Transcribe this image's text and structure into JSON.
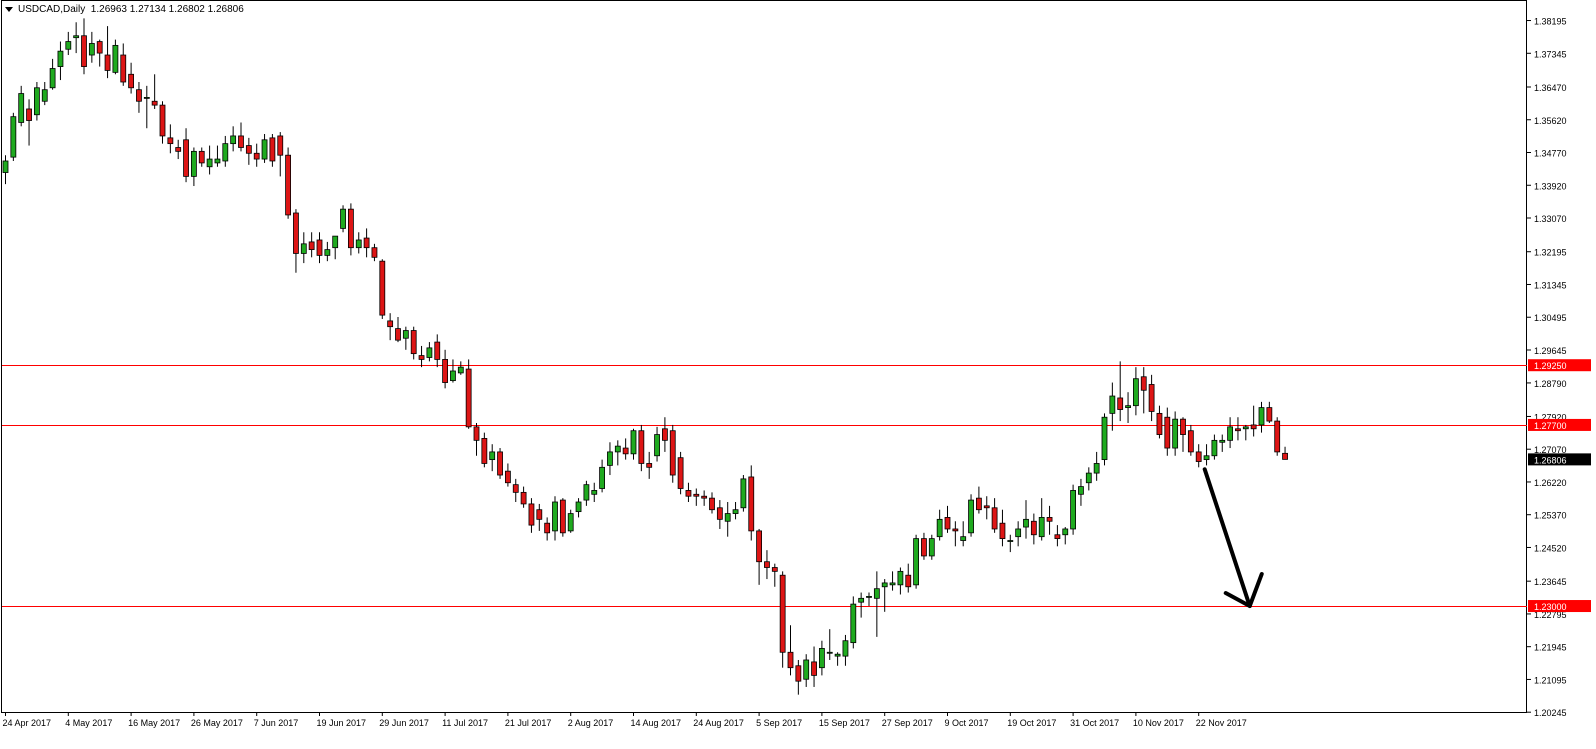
{
  "chart_title": {
    "symbol_tf": "USDCAD,Daily",
    "ohlc": [
      "1.26963",
      "1.27134",
      "1.26802",
      "1.26806"
    ]
  },
  "colors": {
    "bull": "#1faa1f",
    "bear": "#dd1515",
    "level_line": "#ff0000",
    "axis": "#000000",
    "current_price_bg": "#000000",
    "arrow": "#000000"
  },
  "chart_data": {
    "type": "candlestick",
    "symbol": "USDCAD",
    "timeframe": "Daily",
    "ylim": [
      1.2025,
      1.3865
    ],
    "y_ticks": [
      "1.38195",
      "1.37345",
      "1.36470",
      "1.35620",
      "1.34770",
      "1.33920",
      "1.33070",
      "1.32195",
      "1.31345",
      "1.30495",
      "1.29645",
      "1.28790",
      "1.27920",
      "1.27070",
      "1.26220",
      "1.25370",
      "1.24520",
      "1.23645",
      "1.22795",
      "1.21945",
      "1.21095",
      "1.20245"
    ],
    "x_labels": [
      {
        "label": "24 Apr 2017",
        "index": 0
      },
      {
        "label": "4 May 2017",
        "index": 8
      },
      {
        "label": "16 May 2017",
        "index": 16
      },
      {
        "label": "26 May 2017",
        "index": 24
      },
      {
        "label": "7 Jun 2017",
        "index": 32
      },
      {
        "label": "19 Jun 2017",
        "index": 40
      },
      {
        "label": "29 Jun 2017",
        "index": 48
      },
      {
        "label": "11 Jul 2017",
        "index": 56
      },
      {
        "label": "21 Jul 2017",
        "index": 64
      },
      {
        "label": "2 Aug 2017",
        "index": 72
      },
      {
        "label": "14 Aug 2017",
        "index": 80
      },
      {
        "label": "24 Aug 2017",
        "index": 88
      },
      {
        "label": "5 Sep 2017",
        "index": 96
      },
      {
        "label": "15 Sep 2017",
        "index": 104
      },
      {
        "label": "27 Sep 2017",
        "index": 112
      },
      {
        "label": "9 Oct 2017",
        "index": 120
      },
      {
        "label": "19 Oct 2017",
        "index": 128
      },
      {
        "label": "31 Oct 2017",
        "index": 136
      },
      {
        "label": "10 Nov 2017",
        "index": 144
      },
      {
        "label": "22 Nov 2017",
        "index": 152
      }
    ],
    "horizontal_levels": [
      {
        "price": 1.2925,
        "label": "1.29250"
      },
      {
        "price": 1.277,
        "label": "1.27700"
      },
      {
        "price": 1.23,
        "label": "1.23000"
      }
    ],
    "current_price": {
      "price": 1.26806,
      "label": "1.26806"
    },
    "projection_arrow": {
      "from_index": 152,
      "from_price": 1.2655,
      "to_index": 158.5,
      "to_price": 1.23
    },
    "candles": [
      [
        1.3425,
        1.347,
        1.3395,
        1.3455
      ],
      [
        1.3465,
        1.358,
        1.3455,
        1.357
      ],
      [
        1.3555,
        1.365,
        1.3545,
        1.363
      ],
      [
        1.359,
        1.3615,
        1.3495,
        1.356
      ],
      [
        1.3575,
        1.366,
        1.356,
        1.3645
      ],
      [
        1.361,
        1.366,
        1.36,
        1.364
      ],
      [
        1.3645,
        1.372,
        1.364,
        1.3695
      ],
      [
        1.37,
        1.3765,
        1.3665,
        1.374
      ],
      [
        1.3745,
        1.379,
        1.373,
        1.3765
      ],
      [
        1.3775,
        1.3815,
        1.3735,
        1.378
      ],
      [
        1.378,
        1.3825,
        1.368,
        1.37
      ],
      [
        1.373,
        1.379,
        1.371,
        1.376
      ],
      [
        1.3765,
        1.377,
        1.37,
        1.3735
      ],
      [
        1.373,
        1.3805,
        1.367,
        1.369
      ],
      [
        1.3685,
        1.377,
        1.368,
        1.3755
      ],
      [
        1.373,
        1.376,
        1.365,
        1.366
      ],
      [
        1.368,
        1.371,
        1.363,
        1.3645
      ],
      [
        1.364,
        1.366,
        1.358,
        1.361
      ],
      [
        1.362,
        1.365,
        1.354,
        1.362
      ],
      [
        1.361,
        1.368,
        1.359,
        1.36
      ],
      [
        1.36,
        1.361,
        1.35,
        1.352
      ],
      [
        1.3515,
        1.355,
        1.3475,
        1.35
      ],
      [
        1.349,
        1.351,
        1.346,
        1.348
      ],
      [
        1.351,
        1.354,
        1.34,
        1.3415
      ],
      [
        1.3415,
        1.349,
        1.339,
        1.348
      ],
      [
        1.348,
        1.349,
        1.344,
        1.345
      ],
      [
        1.344,
        1.3495,
        1.342,
        1.346
      ],
      [
        1.345,
        1.3495,
        1.344,
        1.346
      ],
      [
        1.3455,
        1.352,
        1.344,
        1.35
      ],
      [
        1.35,
        1.3545,
        1.348,
        1.352
      ],
      [
        1.352,
        1.3555,
        1.348,
        1.349
      ],
      [
        1.3495,
        1.3515,
        1.3445,
        1.3475
      ],
      [
        1.3475,
        1.35,
        1.344,
        1.346
      ],
      [
        1.346,
        1.3525,
        1.345,
        1.351
      ],
      [
        1.3515,
        1.3525,
        1.344,
        1.3455
      ],
      [
        1.352,
        1.353,
        1.3415,
        1.347
      ],
      [
        1.347,
        1.349,
        1.3305,
        1.3315
      ],
      [
        1.332,
        1.333,
        1.3165,
        1.3215
      ],
      [
        1.3215,
        1.327,
        1.319,
        1.324
      ],
      [
        1.3245,
        1.327,
        1.3205,
        1.3225
      ],
      [
        1.325,
        1.327,
        1.319,
        1.321
      ],
      [
        1.321,
        1.3245,
        1.3195,
        1.3225
      ],
      [
        1.323,
        1.326,
        1.32,
        1.326
      ],
      [
        1.328,
        1.334,
        1.327,
        1.333
      ],
      [
        1.333,
        1.3345,
        1.321,
        1.323
      ],
      [
        1.323,
        1.327,
        1.3215,
        1.325
      ],
      [
        1.3255,
        1.328,
        1.3205,
        1.323
      ],
      [
        1.323,
        1.324,
        1.3195,
        1.3205
      ],
      [
        1.3195,
        1.32,
        1.3045,
        1.3055
      ],
      [
        1.304,
        1.306,
        1.299,
        1.3025
      ],
      [
        1.302,
        1.305,
        1.2985,
        1.299
      ],
      [
        1.2995,
        1.3025,
        1.2965,
        1.3015
      ],
      [
        1.3015,
        1.3025,
        1.294,
        1.2955
      ],
      [
        1.295,
        1.2975,
        1.292,
        1.294
      ],
      [
        1.2945,
        1.2985,
        1.2935,
        1.297
      ],
      [
        1.2985,
        1.3005,
        1.292,
        1.294
      ],
      [
        1.294,
        1.2965,
        1.2865,
        1.288
      ],
      [
        1.2885,
        1.294,
        1.288,
        1.291
      ],
      [
        1.2905,
        1.2935,
        1.29,
        1.292
      ],
      [
        1.2915,
        1.294,
        1.276,
        1.2765
      ],
      [
        1.2765,
        1.2775,
        1.269,
        1.273
      ],
      [
        1.2735,
        1.275,
        1.266,
        1.267
      ],
      [
        1.268,
        1.272,
        1.265,
        1.27
      ],
      [
        1.27,
        1.271,
        1.263,
        1.264
      ],
      [
        1.265,
        1.267,
        1.261,
        1.262
      ],
      [
        1.2615,
        1.263,
        1.257,
        1.2595
      ],
      [
        1.2595,
        1.261,
        1.2555,
        1.2565
      ],
      [
        1.2565,
        1.258,
        1.249,
        1.251
      ],
      [
        1.255,
        1.2565,
        1.2495,
        1.2525
      ],
      [
        1.2515,
        1.253,
        1.247,
        1.249
      ],
      [
        1.2495,
        1.2585,
        1.247,
        1.257
      ],
      [
        1.2575,
        1.258,
        1.248,
        1.249
      ],
      [
        1.2495,
        1.255,
        1.249,
        1.254
      ],
      [
        1.2545,
        1.258,
        1.253,
        1.257
      ],
      [
        1.2575,
        1.2625,
        1.256,
        1.2615
      ],
      [
        1.259,
        1.262,
        1.257,
        1.26
      ],
      [
        1.2605,
        1.268,
        1.2595,
        1.266
      ],
      [
        1.2665,
        1.2725,
        1.264,
        1.27
      ],
      [
        1.27,
        1.273,
        1.2665,
        1.2715
      ],
      [
        1.271,
        1.2735,
        1.268,
        1.2695
      ],
      [
        1.2695,
        1.276,
        1.268,
        1.2755
      ],
      [
        1.2755,
        1.277,
        1.265,
        1.267
      ],
      [
        1.267,
        1.27,
        1.263,
        1.266
      ],
      [
        1.269,
        1.2765,
        1.2675,
        1.2745
      ],
      [
        1.276,
        1.279,
        1.27,
        1.273
      ],
      [
        1.2755,
        1.277,
        1.262,
        1.264
      ],
      [
        1.2685,
        1.27,
        1.259,
        1.2605
      ],
      [
        1.26,
        1.262,
        1.257,
        1.2585
      ],
      [
        1.259,
        1.2605,
        1.256,
        1.2585
      ],
      [
        1.2585,
        1.26,
        1.256,
        1.258
      ],
      [
        1.258,
        1.2595,
        1.254,
        1.255
      ],
      [
        1.2555,
        1.2575,
        1.25,
        1.2525
      ],
      [
        1.252,
        1.257,
        1.248,
        1.254
      ],
      [
        1.254,
        1.257,
        1.2525,
        1.255
      ],
      [
        1.2555,
        1.264,
        1.2545,
        1.263
      ],
      [
        1.2635,
        1.2665,
        1.247,
        1.2495
      ],
      [
        1.2495,
        1.25,
        1.2355,
        1.2415
      ],
      [
        1.2415,
        1.2445,
        1.237,
        1.24
      ],
      [
        1.24,
        1.241,
        1.235,
        1.239
      ],
      [
        1.238,
        1.239,
        1.214,
        1.218
      ],
      [
        1.218,
        1.225,
        1.212,
        1.214
      ],
      [
        1.2145,
        1.216,
        1.207,
        1.2105
      ],
      [
        1.211,
        1.2175,
        1.209,
        1.216
      ],
      [
        1.2155,
        1.2195,
        1.209,
        1.212
      ],
      [
        1.214,
        1.221,
        1.212,
        1.219
      ],
      [
        1.218,
        1.224,
        1.216,
        1.218
      ],
      [
        1.217,
        1.218,
        1.2145,
        1.2175
      ],
      [
        1.217,
        1.2225,
        1.2145,
        1.221
      ],
      [
        1.2205,
        1.2325,
        1.219,
        1.2305
      ],
      [
        1.231,
        1.2335,
        1.227,
        1.232
      ],
      [
        1.2325,
        1.2335,
        1.23,
        1.2325
      ],
      [
        1.232,
        1.239,
        1.222,
        1.2345
      ],
      [
        1.235,
        1.237,
        1.2285,
        1.236
      ],
      [
        1.2355,
        1.239,
        1.234,
        1.236
      ],
      [
        1.2355,
        1.24,
        1.233,
        1.239
      ],
      [
        1.238,
        1.241,
        1.2335,
        1.235
      ],
      [
        1.2355,
        1.2485,
        1.2345,
        1.2475
      ],
      [
        1.2475,
        1.249,
        1.242,
        1.243
      ],
      [
        1.243,
        1.2485,
        1.242,
        1.2475
      ],
      [
        1.248,
        1.255,
        1.247,
        1.2525
      ],
      [
        1.253,
        1.256,
        1.249,
        1.25
      ],
      [
        1.25,
        1.252,
        1.2455,
        1.2495
      ],
      [
        1.247,
        1.252,
        1.2455,
        1.248
      ],
      [
        1.249,
        1.259,
        1.248,
        1.2575
      ],
      [
        1.258,
        1.261,
        1.254,
        1.255
      ],
      [
        1.256,
        1.2585,
        1.2525,
        1.2555
      ],
      [
        1.2555,
        1.258,
        1.249,
        1.25
      ],
      [
        1.2515,
        1.255,
        1.2455,
        1.2475
      ],
      [
        1.247,
        1.2485,
        1.244,
        1.247
      ],
      [
        1.248,
        1.252,
        1.2455,
        1.25
      ],
      [
        1.2505,
        1.2575,
        1.2475,
        1.2525
      ],
      [
        1.252,
        1.254,
        1.246,
        1.2485
      ],
      [
        1.248,
        1.258,
        1.247,
        1.253
      ],
      [
        1.253,
        1.256,
        1.2485,
        1.252
      ],
      [
        1.2485,
        1.251,
        1.2455,
        1.2475
      ],
      [
        1.2485,
        1.2505,
        1.246,
        1.25
      ],
      [
        1.25,
        1.2615,
        1.2485,
        1.26
      ],
      [
        1.259,
        1.263,
        1.256,
        1.261
      ],
      [
        1.262,
        1.266,
        1.26,
        1.2645
      ],
      [
        1.2645,
        1.27,
        1.2625,
        1.267
      ],
      [
        1.268,
        1.28,
        1.2665,
        1.279
      ],
      [
        1.28,
        1.288,
        1.2755,
        1.2845
      ],
      [
        1.284,
        1.2935,
        1.278,
        1.281
      ],
      [
        1.2815,
        1.2855,
        1.2775,
        1.282
      ],
      [
        1.282,
        1.292,
        1.2795,
        1.289
      ],
      [
        1.2895,
        1.292,
        1.28,
        1.286
      ],
      [
        1.2875,
        1.29,
        1.278,
        1.2805
      ],
      [
        1.28,
        1.282,
        1.2735,
        1.2745
      ],
      [
        1.279,
        1.2815,
        1.269,
        1.271
      ],
      [
        1.271,
        1.2805,
        1.269,
        1.2785
      ],
      [
        1.2785,
        1.279,
        1.27,
        1.2745
      ],
      [
        1.2755,
        1.277,
        1.269,
        1.27
      ],
      [
        1.27,
        1.272,
        1.266,
        1.2675
      ],
      [
        1.268,
        1.272,
        1.2665,
        1.269
      ],
      [
        1.269,
        1.2745,
        1.268,
        1.273
      ],
      [
        1.2725,
        1.2745,
        1.27,
        1.273
      ],
      [
        1.273,
        1.279,
        1.271,
        1.2765
      ],
      [
        1.276,
        1.279,
        1.273,
        1.2755
      ],
      [
        1.276,
        1.277,
        1.273,
        1.2765
      ],
      [
        1.277,
        1.282,
        1.274,
        1.276
      ],
      [
        1.277,
        1.283,
        1.275,
        1.2815
      ],
      [
        1.2815,
        1.283,
        1.2775,
        1.278
      ],
      [
        1.278,
        1.279,
        1.269,
        1.27
      ],
      [
        1.26963,
        1.27134,
        1.26802,
        1.26806
      ]
    ]
  }
}
